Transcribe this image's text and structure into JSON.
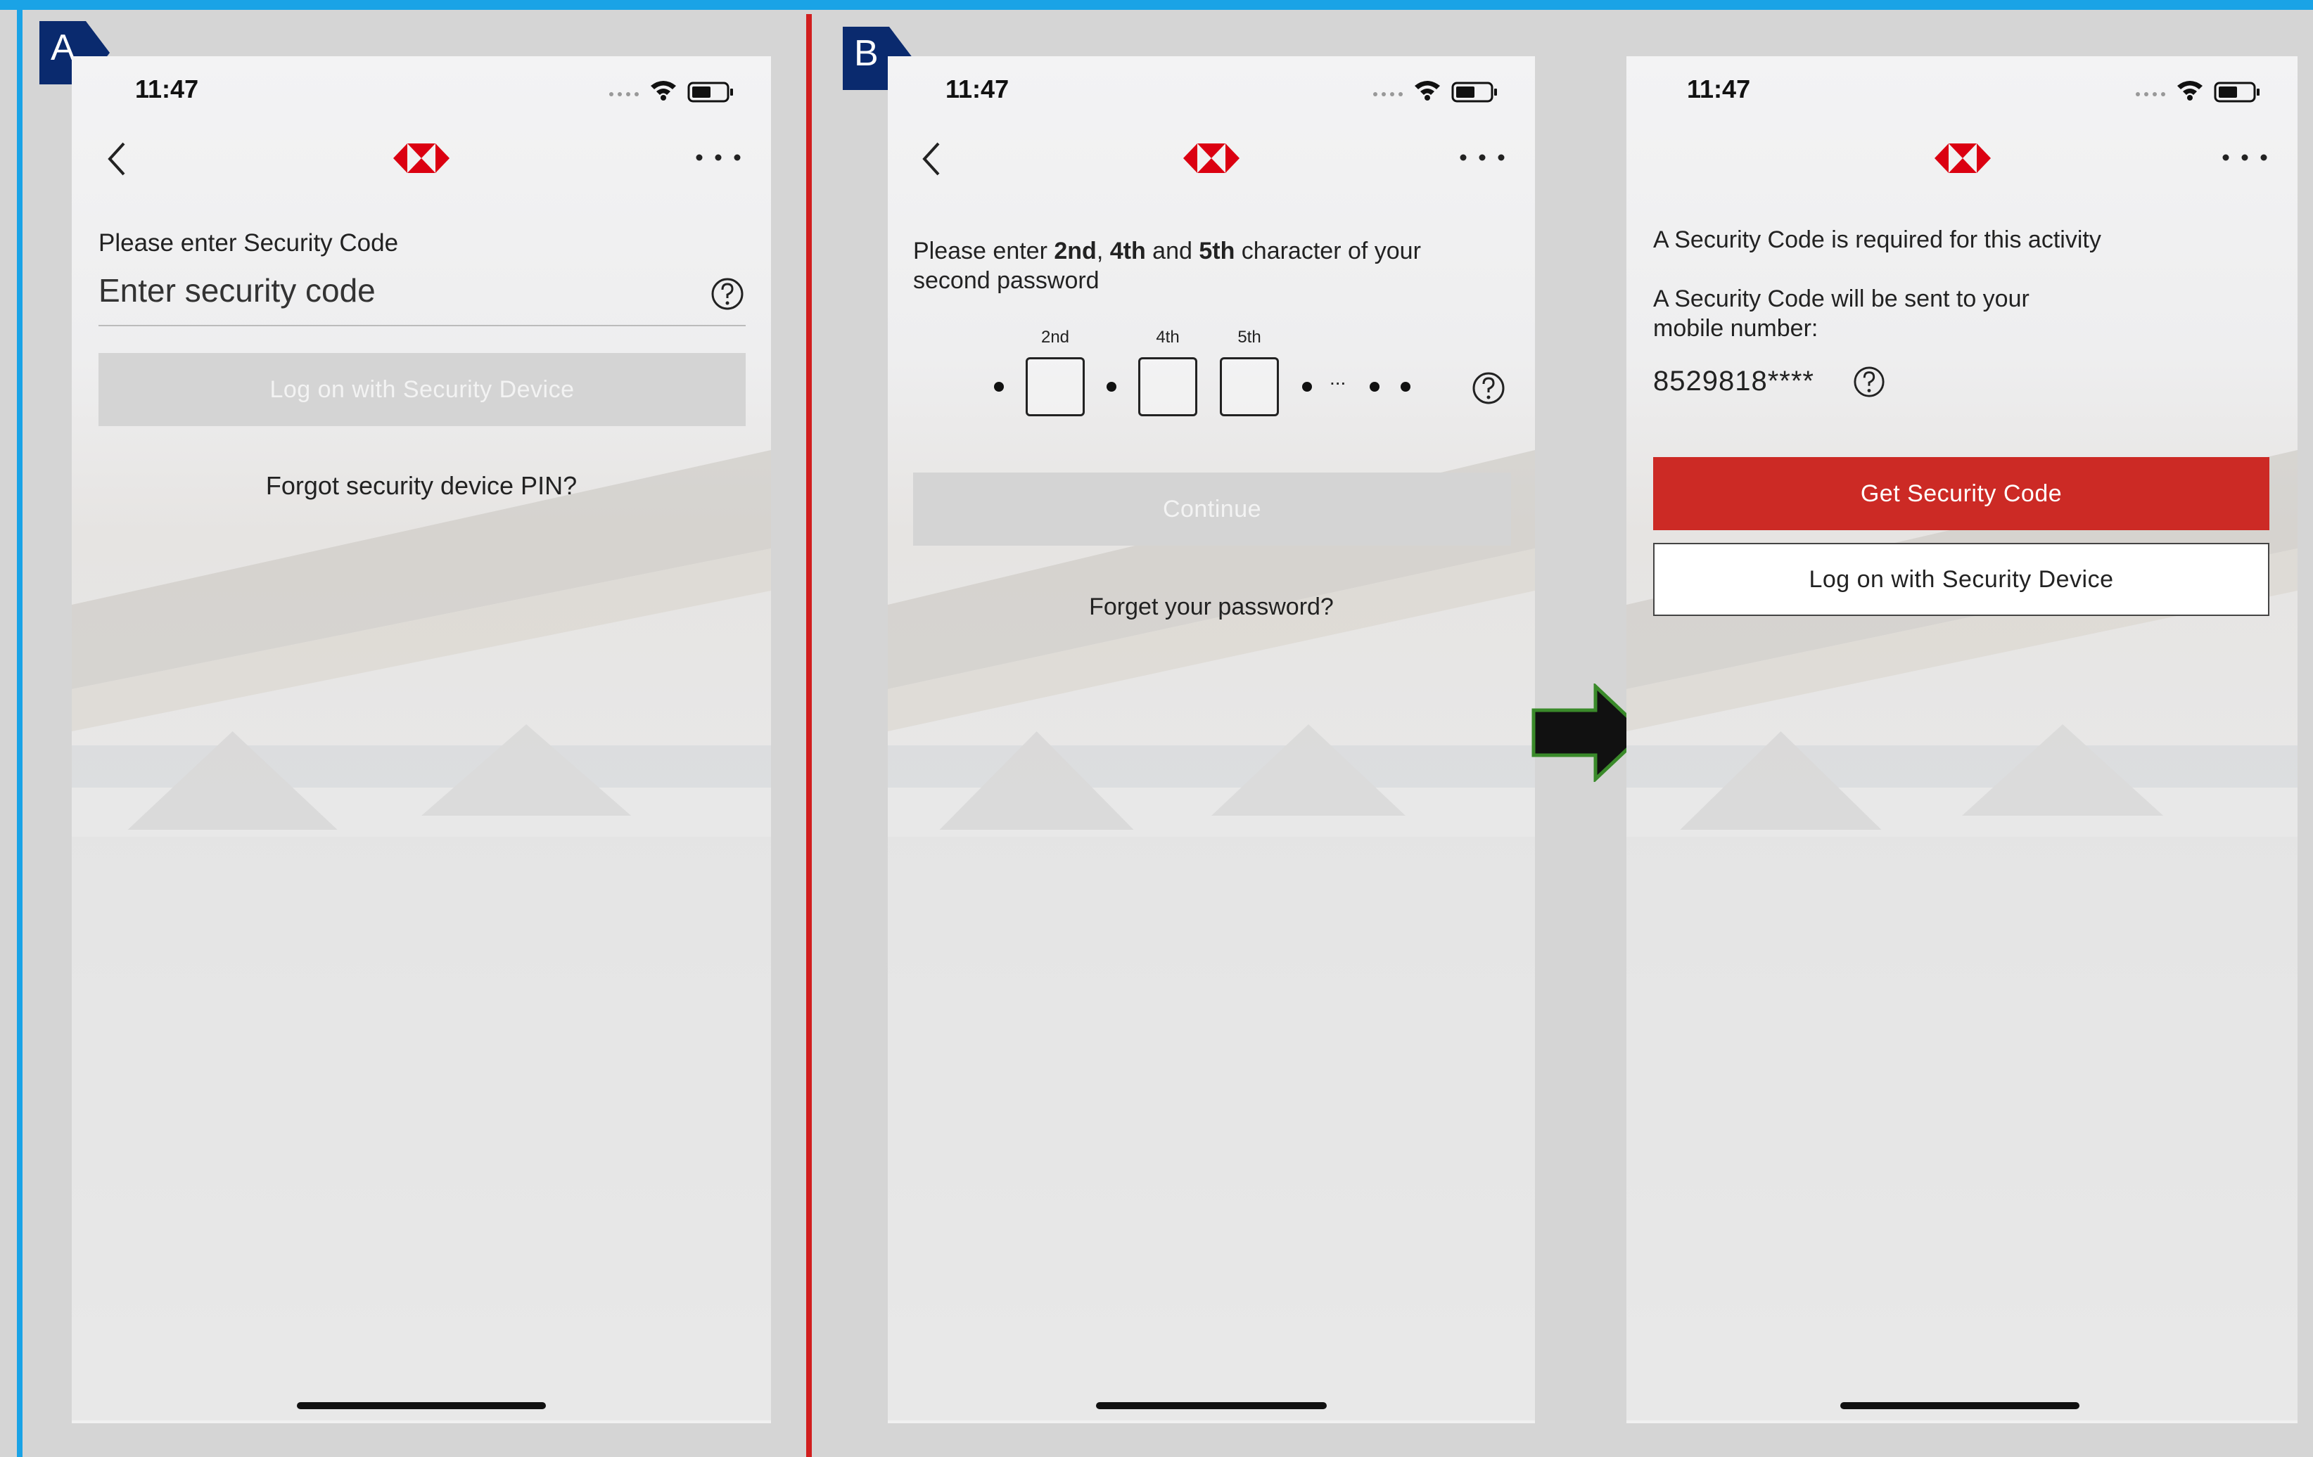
{
  "badges": {
    "a": "A",
    "b": "B"
  },
  "brand_color": "#db0011",
  "screen_a": {
    "time": "11:47",
    "prompt_label": "Please enter Security Code",
    "input_placeholder": "Enter security code",
    "logon_button": "Log on with Security Device",
    "forgot_link": "Forgot security device PIN?"
  },
  "screen_b": {
    "time": "11:47",
    "instruction": {
      "part1": "Please enter ",
      "c1": "2nd",
      "part2": ", ",
      "c2": "4th",
      "part3": " and ",
      "c3": "5th",
      "part4": " character of your",
      "line2": "second password"
    },
    "positions": [
      "2nd",
      "4th",
      "5th"
    ],
    "ellipsis": "...",
    "continue_button": "Continue",
    "forgot_link": "Forget your password?"
  },
  "screen_c": {
    "time": "11:47",
    "required_text": "A Security Code is required for this activity",
    "sent_text_line1": "A Security Code will be sent to your",
    "sent_text_line2": "mobile number:",
    "masked_number": "8529818****",
    "get_code_button": "Get Security Code",
    "logon_button": "Log on with Security Device"
  }
}
